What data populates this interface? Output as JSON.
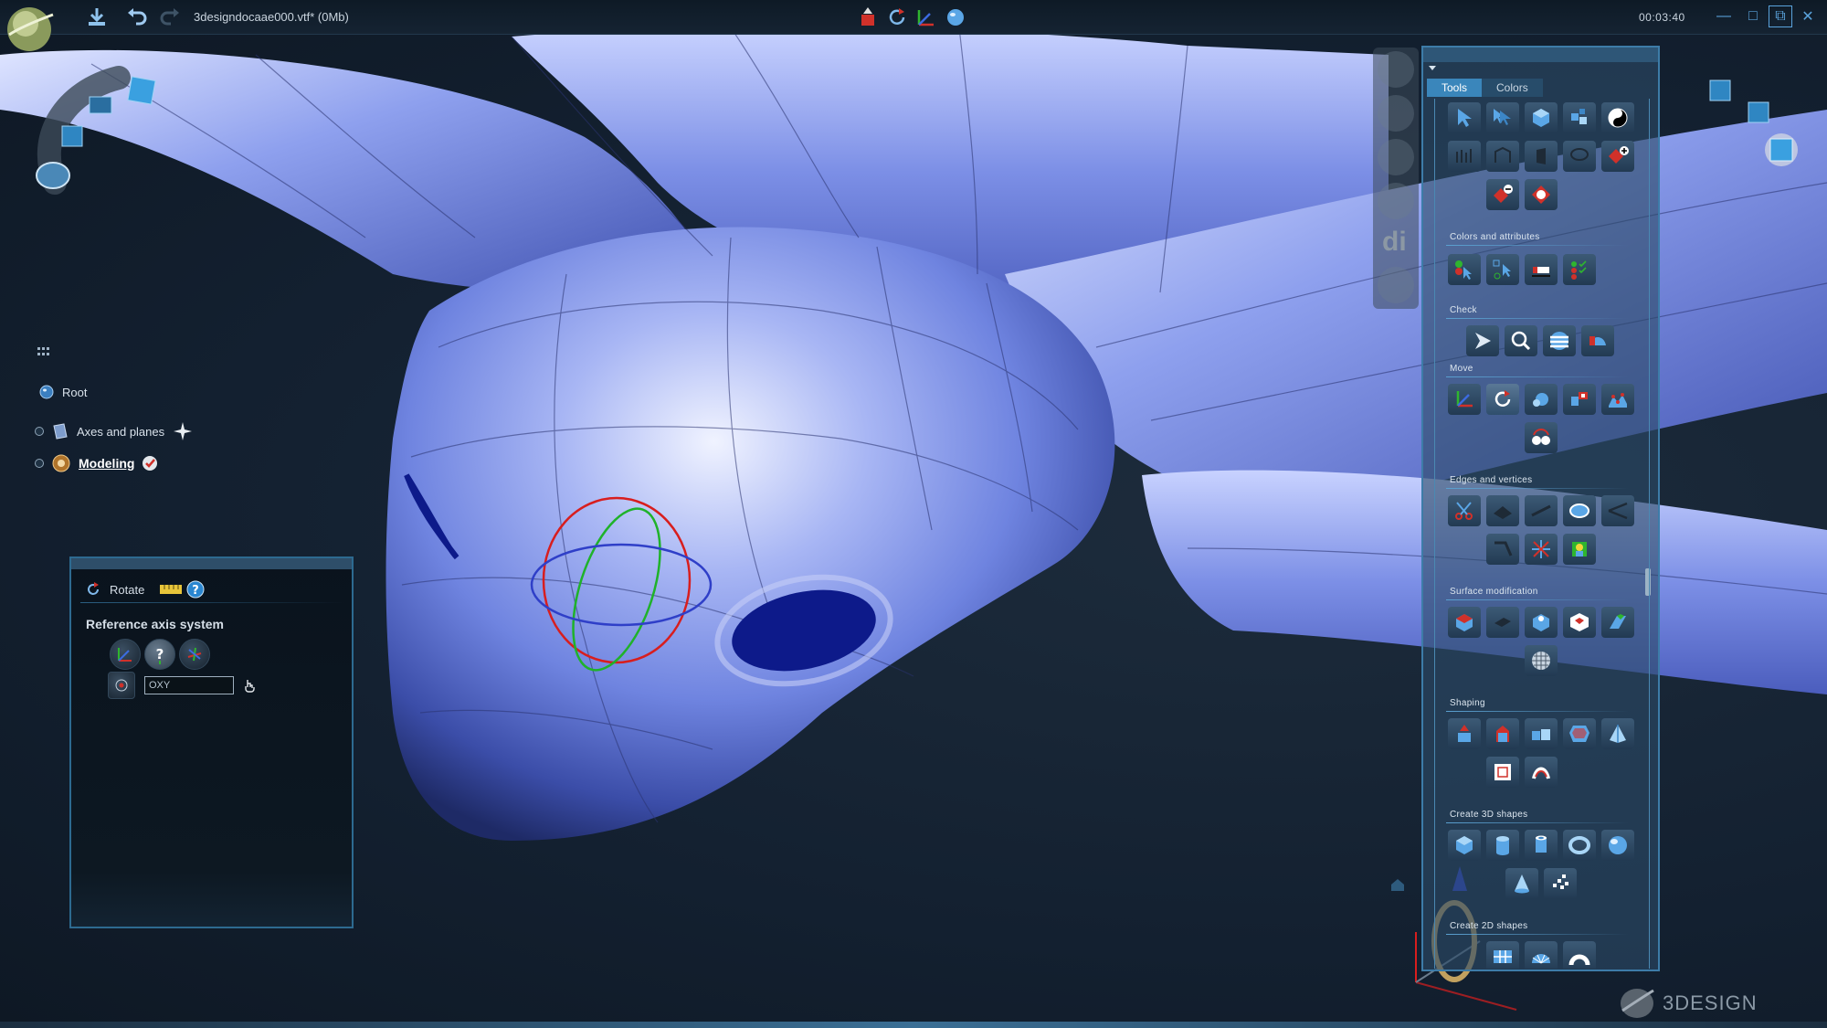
{
  "topbar": {
    "doc_title": "3designdocaae000.vtf* (0Mb)",
    "clock": "00:03:40",
    "save_icon": "save-download-icon",
    "undo_icon": "undo-arrow-icon",
    "redo_icon": "redo-arrow-icon"
  },
  "tree": {
    "root_label": "Root",
    "axes_label": "Axes and planes",
    "modeling_label": "Modeling"
  },
  "rotate_panel": {
    "title": "Rotate",
    "ref_label": "Reference axis system",
    "axis_value": "OXY"
  },
  "tools_panel": {
    "tabs": [
      {
        "label": "Tools",
        "active": true
      },
      {
        "label": "Colors",
        "active": false
      }
    ],
    "sections": {
      "colors": "Colors and attributes",
      "check": "Check",
      "move": "Move",
      "edges": "Edges and vertices",
      "surface": "Surface modification",
      "shaping": "Shaping",
      "create3d": "Create 3D shapes",
      "create2d": "Create 2D shapes"
    }
  },
  "side_strip": {
    "di_label": "di"
  },
  "brand": {
    "name": "3DESIGN"
  },
  "colors": {
    "accent": "#3a86bb",
    "model_blue": "#7f93e6",
    "ring_red": "#d81e1e",
    "ring_green": "#1fb22a",
    "ring_blue": "#2f3fc8"
  }
}
